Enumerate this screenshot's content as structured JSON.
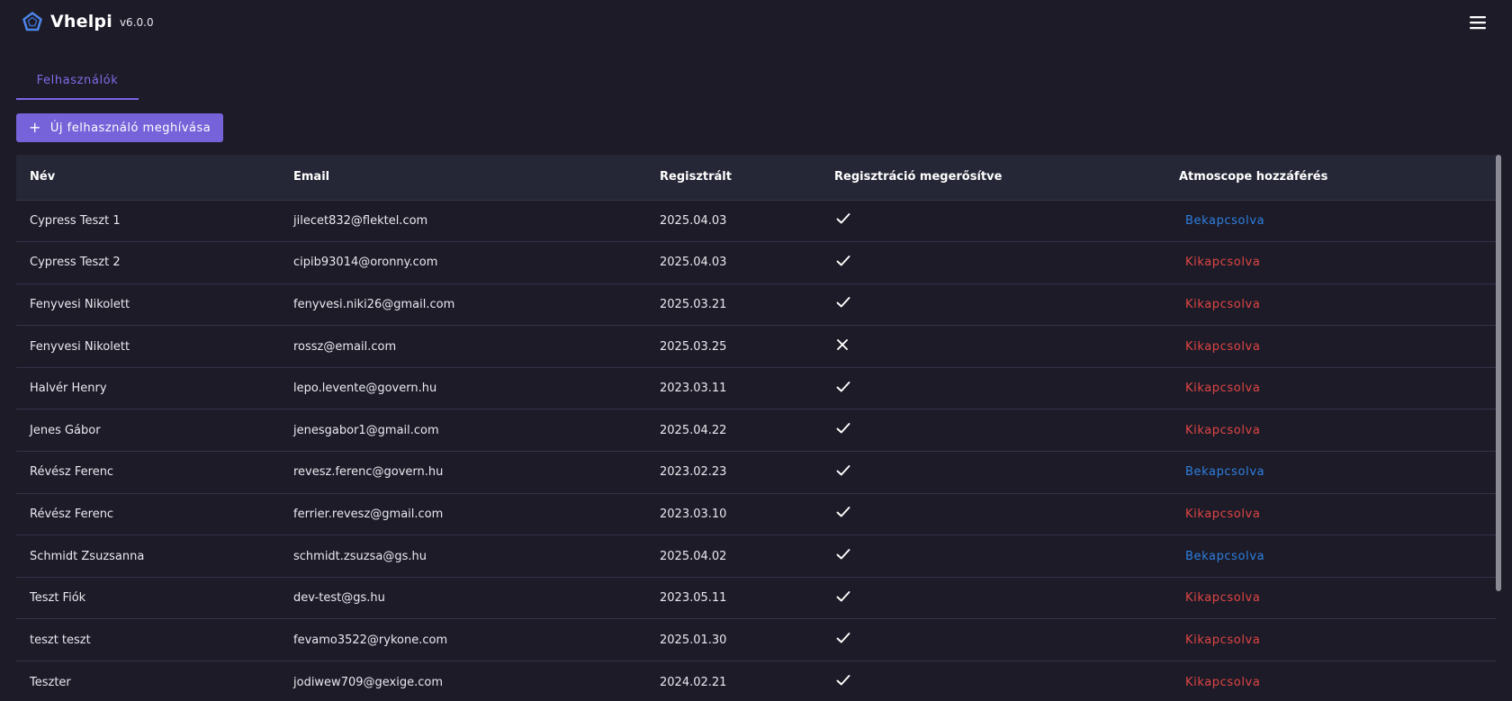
{
  "app": {
    "name": "Vhelpi",
    "version": "v6.0.0"
  },
  "colors": {
    "accent": "#7663d9",
    "enabled": "#2f7fe0",
    "disabled": "#e04545",
    "background": "#1c1b27"
  },
  "icons": {
    "logo": "pentagon-outline-icon",
    "menu": "hamburger-menu-icon",
    "confirmed": "check-icon",
    "not_confirmed": "x-icon",
    "add": "plus-icon"
  },
  "tabs": [
    {
      "label": "Felhasználók",
      "active": true
    }
  ],
  "toolbar": {
    "invite_label": "Új felhasználó meghívása"
  },
  "table": {
    "headers": [
      "Név",
      "Email",
      "Regisztrált",
      "Regisztráció megerősítve",
      "Atmoscope hozzáférés"
    ],
    "rows": [
      {
        "name": "Cypress Teszt 1",
        "email": "jilecet832@flektel.com",
        "registered": "2025.04.03",
        "confirmed": true,
        "access": "Bekapcsolva"
      },
      {
        "name": "Cypress Teszt 2",
        "email": "cipib93014@oronny.com",
        "registered": "2025.04.03",
        "confirmed": true,
        "access": "Kikapcsolva"
      },
      {
        "name": "Fenyvesi Nikolett",
        "email": "fenyvesi.niki26@gmail.com",
        "registered": "2025.03.21",
        "confirmed": true,
        "access": "Kikapcsolva"
      },
      {
        "name": "Fenyvesi Nikolett",
        "email": "rossz@email.com",
        "registered": "2025.03.25",
        "confirmed": false,
        "access": "Kikapcsolva"
      },
      {
        "name": "Halvér Henry",
        "email": "lepo.levente@govern.hu",
        "registered": "2023.03.11",
        "confirmed": true,
        "access": "Kikapcsolva"
      },
      {
        "name": "Jenes Gábor",
        "email": "jenesgabor1@gmail.com",
        "registered": "2025.04.22",
        "confirmed": true,
        "access": "Kikapcsolva"
      },
      {
        "name": "Révész Ferenc",
        "email": "revesz.ferenc@govern.hu",
        "registered": "2023.02.23",
        "confirmed": true,
        "access": "Bekapcsolva"
      },
      {
        "name": "Révész Ferenc",
        "email": "ferrier.revesz@gmail.com",
        "registered": "2023.03.10",
        "confirmed": true,
        "access": "Kikapcsolva"
      },
      {
        "name": "Schmidt Zsuzsanna",
        "email": "schmidt.zsuzsa@gs.hu",
        "registered": "2025.04.02",
        "confirmed": true,
        "access": "Bekapcsolva"
      },
      {
        "name": "Teszt Fiók",
        "email": "dev-test@gs.hu",
        "registered": "2023.05.11",
        "confirmed": true,
        "access": "Kikapcsolva"
      },
      {
        "name": "teszt teszt",
        "email": "fevamo3522@rykone.com",
        "registered": "2025.01.30",
        "confirmed": true,
        "access": "Kikapcsolva"
      },
      {
        "name": "Teszter",
        "email": "jodiwew709@gexige.com",
        "registered": "2024.02.21",
        "confirmed": true,
        "access": "Kikapcsolva"
      }
    ]
  }
}
